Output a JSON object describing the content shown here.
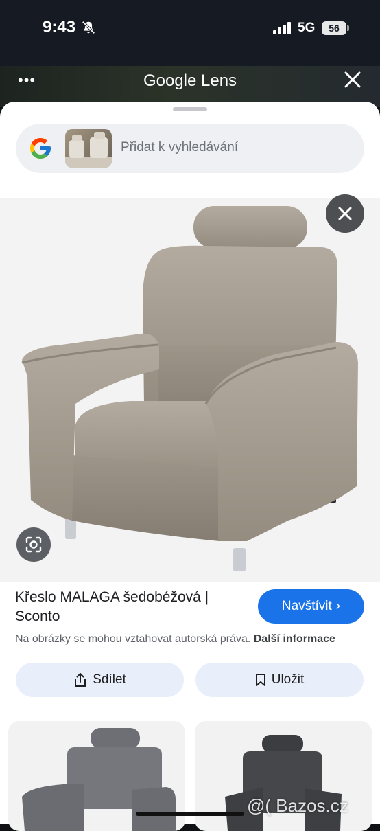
{
  "status": {
    "time": "9:43",
    "network": "5G",
    "battery": "56"
  },
  "header": {
    "more_icon": "more-horizontal-icon",
    "title": "Google Lens",
    "close_icon": "close-icon"
  },
  "search": {
    "placeholder": "Přidat k vyhledávání"
  },
  "result": {
    "title": "Křeslo MALAGA šedobéžová | Sconto",
    "visit_label": "Navštívit",
    "copyright_text": "Na obrázky se mohou vztahovat autorská práva.",
    "more_info_label": "Další informace"
  },
  "actions": {
    "share_label": "Sdílet",
    "save_label": "Uložit"
  },
  "watermark": "@( Bazos.cz",
  "colors": {
    "accent": "#1a73e8",
    "pill_background": "#e8effb",
    "chair_fabric": "#a39a8e"
  }
}
